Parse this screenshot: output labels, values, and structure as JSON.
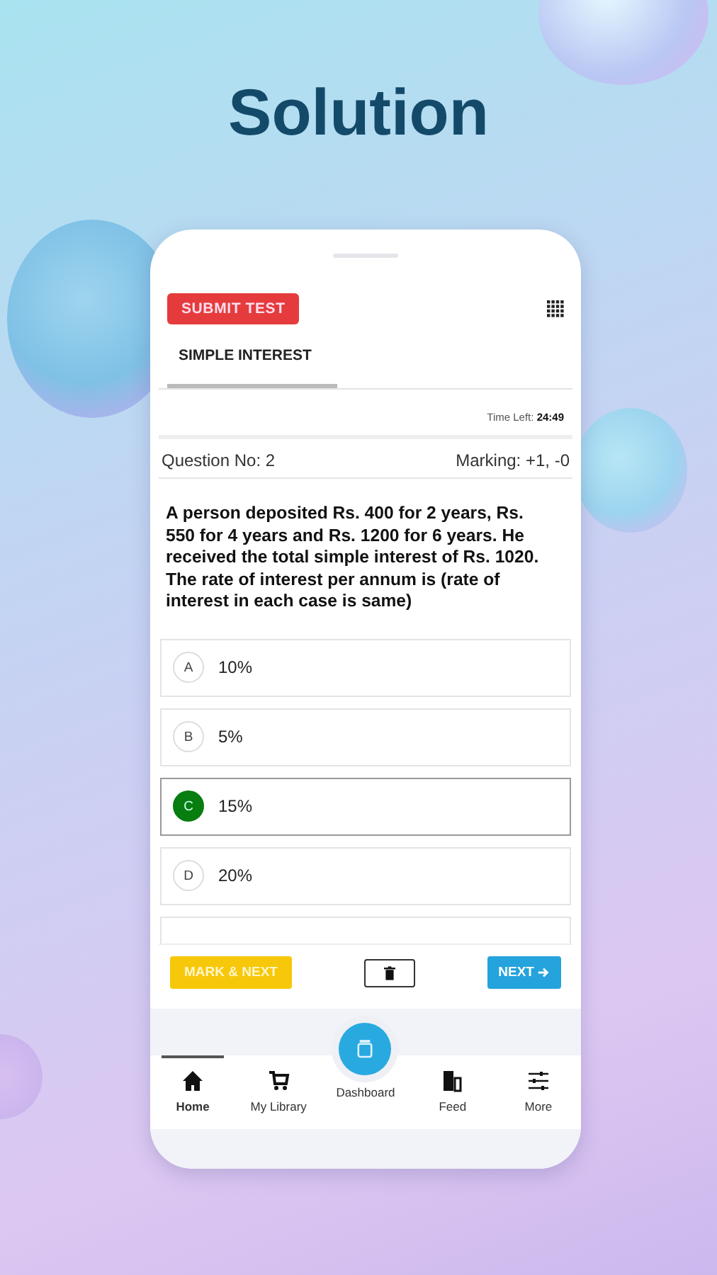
{
  "headline": "Solution",
  "header": {
    "submit_button": "SUBMIT TEST"
  },
  "tabs": [
    {
      "label": "SIMPLE INTEREST",
      "selected": true
    }
  ],
  "timer": {
    "label": "Time Left:",
    "value": "24:49"
  },
  "question": {
    "number": "Question No: 2",
    "marking": "Marking: +1, -0",
    "text": "A person deposited Rs. 400 for 2 years, Rs. 550 for 4 years and Rs. 1200 for 6 years. He received the total simple interest of Rs. 1020. The rate of interest per annum is (rate of interest in each case is same)"
  },
  "options": [
    {
      "letter": "A",
      "text": "10%",
      "selected": false
    },
    {
      "letter": "B",
      "text": "5%",
      "selected": false
    },
    {
      "letter": "C",
      "text": "15%",
      "selected": true
    },
    {
      "letter": "D",
      "text": "20%",
      "selected": false
    }
  ],
  "actions": {
    "mark_next": "MARK & NEXT",
    "next": "NEXT"
  },
  "nav": [
    {
      "kind": "home",
      "label": "Home",
      "selected": true
    },
    {
      "kind": "cart",
      "label": "My Library",
      "selected": false
    },
    {
      "kind": "dashboard",
      "label": "Dashboard",
      "selected": false
    },
    {
      "kind": "feed",
      "label": "Feed",
      "selected": false
    },
    {
      "kind": "more",
      "label": "More",
      "selected": false
    }
  ]
}
